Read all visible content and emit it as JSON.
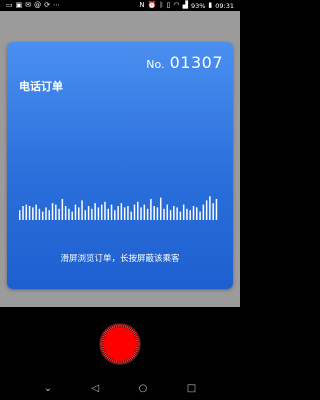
{
  "status_bar": {
    "left_icons": [
      "screen-mirror-icon",
      "image-icon",
      "mail-icon",
      "at-icon",
      "sync-icon",
      "more-dots-icon"
    ],
    "right_icons": [
      "nfc-icon",
      "alarm-icon",
      "bluetooth-icon",
      "vibrate-icon",
      "wifi-icon",
      "signal-icon"
    ],
    "battery_percent": "93%",
    "time": "09:31"
  },
  "card": {
    "number_prefix": "No.",
    "number_value": "01307",
    "title": "电话订单",
    "hint": "滑屏浏览订单，长按屏蔽该乘客",
    "waveform_levels": [
      0.35,
      0.5,
      0.55,
      0.5,
      0.45,
      0.55,
      0.4,
      0.3,
      0.45,
      0.35,
      0.6,
      0.55,
      0.4,
      0.75,
      0.5,
      0.4,
      0.3,
      0.55,
      0.45,
      0.7,
      0.35,
      0.5,
      0.4,
      0.6,
      0.45,
      0.55,
      0.65,
      0.4,
      0.55,
      0.35,
      0.5,
      0.6,
      0.45,
      0.5,
      0.3,
      0.55,
      0.65,
      0.45,
      0.55,
      0.4,
      0.75,
      0.5,
      0.45,
      0.8,
      0.4,
      0.55,
      0.35,
      0.5,
      0.45,
      0.3,
      0.55,
      0.4,
      0.35,
      0.5,
      0.45,
      0.3,
      0.55,
      0.7,
      0.85,
      0.6,
      0.75
    ]
  },
  "nav": {
    "back": "◁",
    "home": "○",
    "recents": "□",
    "menu": "⌄"
  },
  "colors": {
    "card_top": "#4a8ff0",
    "card_bottom": "#1e5fcf",
    "record": "#ff0000",
    "background": "#9b9b9b"
  }
}
